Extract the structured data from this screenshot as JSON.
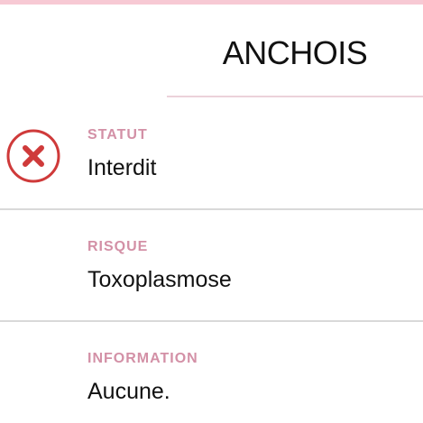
{
  "header": {
    "title": "ANCHOIS"
  },
  "rows": [
    {
      "label": "STATUT",
      "value": "Interdit"
    },
    {
      "label": "RISQUE",
      "value": "Toxoplasmose"
    },
    {
      "label": "INFORMATION",
      "value": "Aucune."
    }
  ],
  "status_icon": {
    "name": "forbidden-x-icon",
    "color": "#cf3a3a"
  },
  "colors": {
    "accent_pink": "#f7c9d4",
    "label_pink": "#d390a6",
    "divider_gray": "#d9d9d9"
  }
}
